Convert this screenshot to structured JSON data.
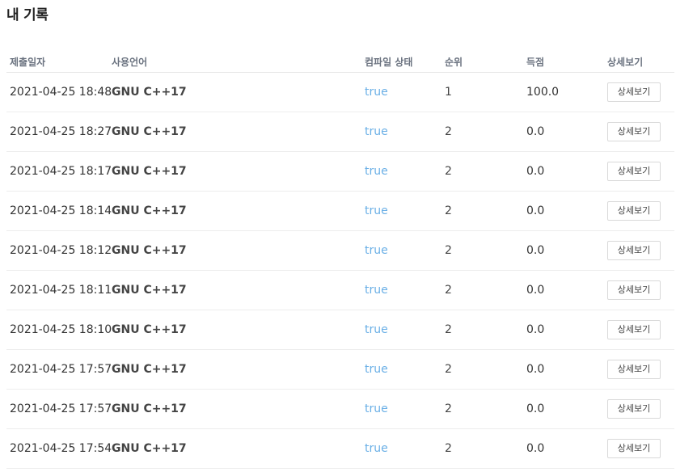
{
  "page": {
    "title": "내 기록"
  },
  "table": {
    "headers": {
      "date": "제출일자",
      "language": "사용언어",
      "compile": "컴파일 상태",
      "rank": "순위",
      "score": "득점",
      "detail": "상세보기"
    },
    "rows": [
      {
        "date": "2021-04-25 18:48",
        "language": "GNU C++17",
        "compile": "true",
        "rank": "1",
        "score": "100.0",
        "detail": "상세보기"
      },
      {
        "date": "2021-04-25 18:27",
        "language": "GNU C++17",
        "compile": "true",
        "rank": "2",
        "score": "0.0",
        "detail": "상세보기"
      },
      {
        "date": "2021-04-25 18:17",
        "language": "GNU C++17",
        "compile": "true",
        "rank": "2",
        "score": "0.0",
        "detail": "상세보기"
      },
      {
        "date": "2021-04-25 18:14",
        "language": "GNU C++17",
        "compile": "true",
        "rank": "2",
        "score": "0.0",
        "detail": "상세보기"
      },
      {
        "date": "2021-04-25 18:12",
        "language": "GNU C++17",
        "compile": "true",
        "rank": "2",
        "score": "0.0",
        "detail": "상세보기"
      },
      {
        "date": "2021-04-25 18:11",
        "language": "GNU C++17",
        "compile": "true",
        "rank": "2",
        "score": "0.0",
        "detail": "상세보기"
      },
      {
        "date": "2021-04-25 18:10",
        "language": "GNU C++17",
        "compile": "true",
        "rank": "2",
        "score": "0.0",
        "detail": "상세보기"
      },
      {
        "date": "2021-04-25 17:57",
        "language": "GNU C++17",
        "compile": "true",
        "rank": "2",
        "score": "0.0",
        "detail": "상세보기"
      },
      {
        "date": "2021-04-25 17:57",
        "language": "GNU C++17",
        "compile": "true",
        "rank": "2",
        "score": "0.0",
        "detail": "상세보기"
      },
      {
        "date": "2021-04-25 17:54",
        "language": "GNU C++17",
        "compile": "true",
        "rank": "2",
        "score": "0.0",
        "detail": "상세보기"
      }
    ]
  },
  "colors": {
    "compile_true": "#6aafe6",
    "header_text": "#6b7380"
  }
}
